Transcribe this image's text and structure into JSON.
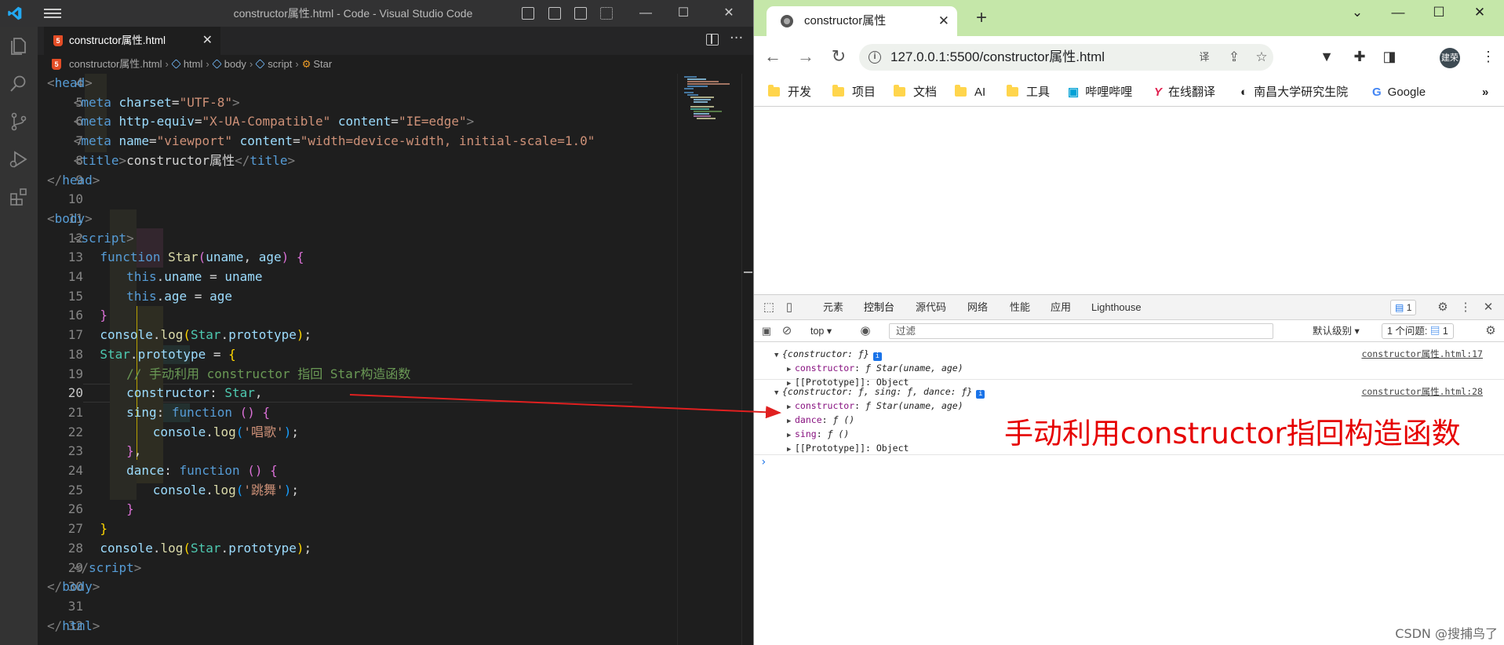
{
  "vscode": {
    "window_title": "constructor属性.html - Code - Visual Studio Code",
    "tab_label": "constructor属性.html",
    "breadcrumb": [
      "constructor属性.html",
      "html",
      "body",
      "script",
      "Star"
    ],
    "current_line": 20,
    "lines": [
      {
        "n": "4"
      },
      {
        "n": "5"
      },
      {
        "n": "6"
      },
      {
        "n": "7"
      },
      {
        "n": "8"
      },
      {
        "n": "9"
      },
      {
        "n": "10"
      },
      {
        "n": "11"
      },
      {
        "n": "12"
      },
      {
        "n": "13"
      },
      {
        "n": "14"
      },
      {
        "n": "15"
      },
      {
        "n": "16"
      },
      {
        "n": "17"
      },
      {
        "n": "18"
      },
      {
        "n": "19"
      },
      {
        "n": "20"
      },
      {
        "n": "21"
      },
      {
        "n": "22"
      },
      {
        "n": "23"
      },
      {
        "n": "24"
      },
      {
        "n": "25"
      },
      {
        "n": "26"
      },
      {
        "n": "27"
      },
      {
        "n": "28"
      },
      {
        "n": "29"
      },
      {
        "n": "30"
      },
      {
        "n": "31"
      },
      {
        "n": "32"
      }
    ],
    "code": {
      "l4": [
        "<",
        "head",
        ">"
      ],
      "l5": [
        "<",
        "meta",
        " charset",
        "=",
        "\"UTF-8\"",
        ">"
      ],
      "l6": [
        "<",
        "meta",
        " http-equiv",
        "=",
        "\"X-UA-Compatible\"",
        " content",
        "=",
        "\"IE=edge\"",
        ">"
      ],
      "l7": [
        "<",
        "meta",
        " name",
        "=",
        "\"viewport\"",
        " content",
        "=",
        "\"width=device-width, initial-scale=1.0\""
      ],
      "l8": [
        "<",
        "title",
        ">",
        "constructor属性",
        "</",
        "title",
        ">"
      ],
      "l9": [
        "</",
        "head",
        ">"
      ],
      "l11": [
        "<",
        "body",
        ">"
      ],
      "l12": [
        "<",
        "script",
        ">"
      ],
      "l13": [
        "function",
        " ",
        "Star",
        "(",
        "uname",
        ", ",
        "age",
        ")",
        " ",
        "{"
      ],
      "l14": [
        "this",
        ".",
        "uname",
        " = ",
        "uname"
      ],
      "l15": [
        "this",
        ".",
        "age",
        " = ",
        "age"
      ],
      "l16": [
        "}"
      ],
      "l17": [
        "console",
        ".",
        "log",
        "(",
        "Star",
        ".",
        "prototype",
        ")",
        ";"
      ],
      "l18": [
        "Star",
        ".",
        "prototype",
        " = ",
        "{"
      ],
      "l19": [
        "// 手动利用 constructor 指回 Star构造函数"
      ],
      "l20": [
        "constructor",
        ": ",
        "Star",
        ","
      ],
      "l21": [
        "sing",
        ": ",
        "function",
        " ",
        "()",
        " ",
        "{"
      ],
      "l22": [
        "console",
        ".",
        "log",
        "(",
        "'唱歌'",
        ")",
        ";"
      ],
      "l23": [
        "}",
        ","
      ],
      "l24": [
        "dance",
        ": ",
        "function",
        " ",
        "()",
        " ",
        "{"
      ],
      "l25": [
        "console",
        ".",
        "log",
        "(",
        "'跳舞'",
        ")",
        ";"
      ],
      "l26": [
        "}"
      ],
      "l27": [
        "}"
      ],
      "l28": [
        "console",
        ".",
        "log",
        "(",
        "Star",
        ".",
        "prototype",
        ")",
        ";"
      ],
      "l29": [
        "</",
        "script",
        ">"
      ],
      "l30": [
        "</",
        "body",
        ">"
      ],
      "l32": [
        "</",
        "html",
        ">"
      ]
    }
  },
  "chrome": {
    "tab_title": "constructor属性",
    "url": "127.0.0.1:5500/constructor属性.html",
    "profile_label": "建荣",
    "bookmarks": [
      "开发",
      "项目",
      "文档",
      "AI",
      "工具",
      "哔哩哔哩",
      "在线翻译",
      "南昌大学研究生院",
      "Google"
    ],
    "bookmarks_more": "»"
  },
  "devtools": {
    "tabs": [
      "元素",
      "控制台",
      "源代码",
      "网络",
      "性能",
      "应用",
      "Lighthouse"
    ],
    "active_tab": "控制台",
    "issues_badge": "1",
    "context": "top",
    "filter_placeholder": "过滤",
    "level": "默认级别",
    "issues_text": "1 个问题:",
    "issues_count": "1",
    "log1": {
      "summary": "{constructor: ƒ}",
      "link": "constructor属性.html:17",
      "constructor_key": "constructor",
      "constructor_val": "ƒ Star(uname, age)",
      "proto_key": "[[Prototype]]",
      "proto_val": "Object"
    },
    "log2": {
      "summary": "{constructor: ƒ, sing: ƒ, dance: ƒ}",
      "link": "constructor属性.html:28",
      "constructor_key": "constructor",
      "constructor_val": "ƒ Star(uname, age)",
      "dance_key": "dance",
      "dance_val": "ƒ ()",
      "sing_key": "sing",
      "sing_val": "ƒ ()",
      "proto_key": "[[Prototype]]",
      "proto_val": "Object"
    },
    "prompt": "›"
  },
  "annotation": "手动利用constructor指回构造函数",
  "watermark": "CSDN @搜捕鸟了",
  "colors": {
    "annotation": "#e60000",
    "vscode_bg": "#1e1e1e",
    "chrome_frame": "#c5e7a9"
  }
}
